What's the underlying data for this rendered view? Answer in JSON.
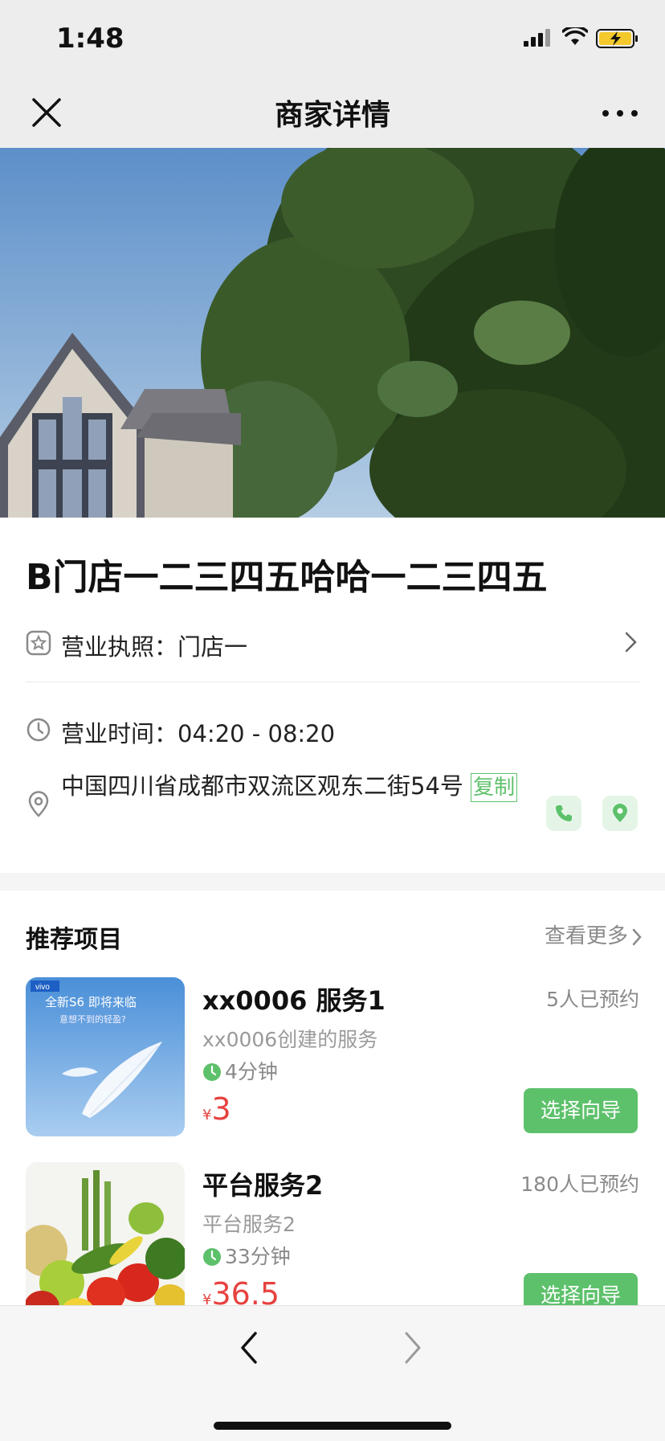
{
  "status": {
    "time": "1:48"
  },
  "nav": {
    "title": "商家详情"
  },
  "store": {
    "name": "B门店一二三四五哈哈一二三四五",
    "license_label": "营业执照：",
    "license_value": "门店一",
    "hours_label": "营业时间：",
    "hours_value": "04:20 - 08:20",
    "address": "中国四川省成都市双流区观东二街54号",
    "copy_label": "复制"
  },
  "recommend": {
    "title": "推荐项目",
    "more": "查看更多",
    "items": [
      {
        "name": "xx0006 服务1",
        "count": "5人已预约",
        "desc": "xx0006创建的服务",
        "duration": "4分钟",
        "currency": "¥",
        "price": "3",
        "button": "选择向导",
        "thumb_brand": "vivo",
        "thumb_title": "全新S6 即将来临",
        "thumb_sub": "意想不到的轻盈?"
      },
      {
        "name": "平台服务2",
        "count": "180人已预约",
        "desc": "平台服务2",
        "duration": "33分钟",
        "currency": "¥",
        "price": "36.5",
        "button": "选择向导"
      }
    ]
  },
  "colors": {
    "accent": "#5dc16b",
    "price": "#e64340"
  }
}
